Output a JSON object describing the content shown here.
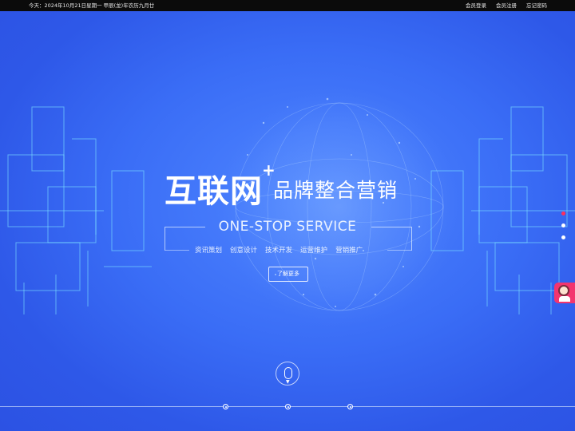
{
  "topbar": {
    "date": "今天：2024年10月21日星期一   甲辰(龙)年农历九月廿",
    "links": [
      "会员登录",
      "会员注册",
      "忘记密码"
    ]
  },
  "hero": {
    "headline_big": "互联网",
    "headline_plus": "+",
    "headline_sub": "品牌整合营销",
    "service": "ONE-STOP SERVICE",
    "features": [
      "资讯策划",
      "创意设计",
      "技术开发",
      "运营维护",
      "营销推广"
    ],
    "learn_more": "了解更多"
  },
  "slider": {
    "dots": 3,
    "active": 0
  },
  "icons": {
    "scroll": "mouse-scroll-icon",
    "support": "customer-service-icon"
  },
  "colors": {
    "background": "#3b68f0",
    "active_dot": "#ff2e5c",
    "support": "#f3356e"
  }
}
